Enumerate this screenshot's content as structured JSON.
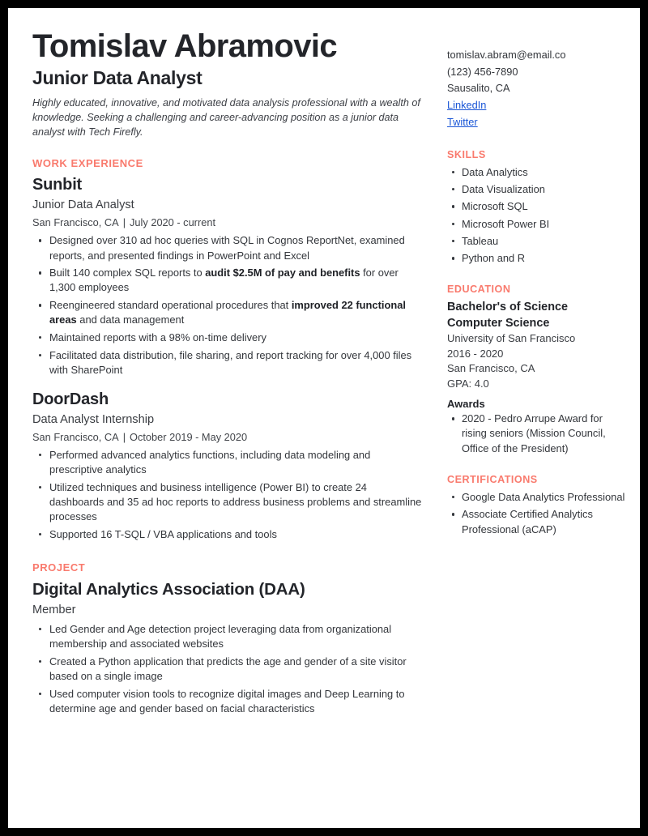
{
  "header": {
    "name": "Tomislav Abramovic",
    "job_title": "Junior Data Analyst",
    "summary": "Highly educated, innovative, and motivated data analysis professional with a wealth of knowledge. Seeking a challenging and career-advancing position as a junior data analyst with Tech Firefly."
  },
  "contact": {
    "email": "tomislav.abram@email.co",
    "phone": "(123) 456-7890",
    "location": "Sausalito, CA",
    "links": [
      {
        "label": "LinkedIn"
      },
      {
        "label": "Twitter"
      }
    ],
    "link_color": "#1a56d6"
  },
  "accent_color": "#F97A6D",
  "text_color": "#23252A",
  "sections": {
    "work": {
      "heading": "WORK EXPERIENCE",
      "entries": [
        {
          "org": "Sunbit",
          "role": "Junior Data Analyst",
          "location": "San Francisco, CA",
          "separator": "|",
          "dates": "July 2020 - current",
          "bullets": [
            [
              {
                "t": "Designed over 310 ad hoc queries with SQL in Cognos ReportNet, examined reports, and presented findings in PowerPoint and Excel",
                "b": false
              }
            ],
            [
              {
                "t": "Built 140 complex SQL reports to ",
                "b": false
              },
              {
                "t": "audit $2.5M of pay and benefits",
                "b": true
              },
              {
                "t": " for over 1,300 employees",
                "b": false
              }
            ],
            [
              {
                "t": "Reengineered standard operational procedures that ",
                "b": false
              },
              {
                "t": "improved 22 functional areas",
                "b": true
              },
              {
                "t": " and data management",
                "b": false
              }
            ],
            [
              {
                "t": "Maintained reports with a 98% on-time delivery",
                "b": false
              }
            ],
            [
              {
                "t": "Facilitated data distribution, file sharing, and report tracking for over 4,000 files with SharePoint",
                "b": false
              }
            ]
          ]
        },
        {
          "org": "DoorDash",
          "role": "Data Analyst Internship",
          "location": "San Francisco, CA",
          "separator": "|",
          "dates": "October 2019 - May 2020",
          "bullets": [
            [
              {
                "t": "Performed advanced analytics functions, including data modeling and prescriptive analytics",
                "b": false
              }
            ],
            [
              {
                "t": "Utilized techniques and business intelligence (Power BI) to create 24 dashboards and 35 ad hoc reports to address business problems and streamline processes",
                "b": false
              }
            ],
            [
              {
                "t": "Supported 16 T-SQL / VBA applications and tools",
                "b": false
              }
            ]
          ]
        }
      ]
    },
    "project": {
      "heading": "PROJECT",
      "title": "Digital Analytics Association (DAA)",
      "role": "Member",
      "bullets": [
        "Led Gender and Age detection project leveraging data from organizational membership and associated websites",
        "Created a Python application that predicts the age and gender of a site visitor based on a single image",
        "Used computer vision tools to recognize digital images and Deep Learning to determine age and gender based on facial characteristics"
      ]
    },
    "skills": {
      "heading": "SKILLS",
      "items": [
        "Data Analytics",
        "Data Visualization",
        "Microsoft SQL",
        "Microsoft Power BI",
        "Tableau",
        "Python and R"
      ]
    },
    "education": {
      "heading": "EDUCATION",
      "degree_line1": "Bachelor's of Science",
      "degree_line2": "Computer Science",
      "school": "University of San Francisco",
      "years": "2016 - 2020",
      "location": "San Francisco, CA",
      "gpa": "GPA: 4.0",
      "awards_heading": "Awards",
      "awards": [
        "2020 - Pedro Arrupe Award for rising seniors (Mission Council, Office of the President)"
      ]
    },
    "certifications": {
      "heading": "CERTIFICATIONS",
      "items": [
        "Google Data Analytics Professional",
        "Associate Certified Analytics Professional (aCAP)"
      ]
    }
  }
}
